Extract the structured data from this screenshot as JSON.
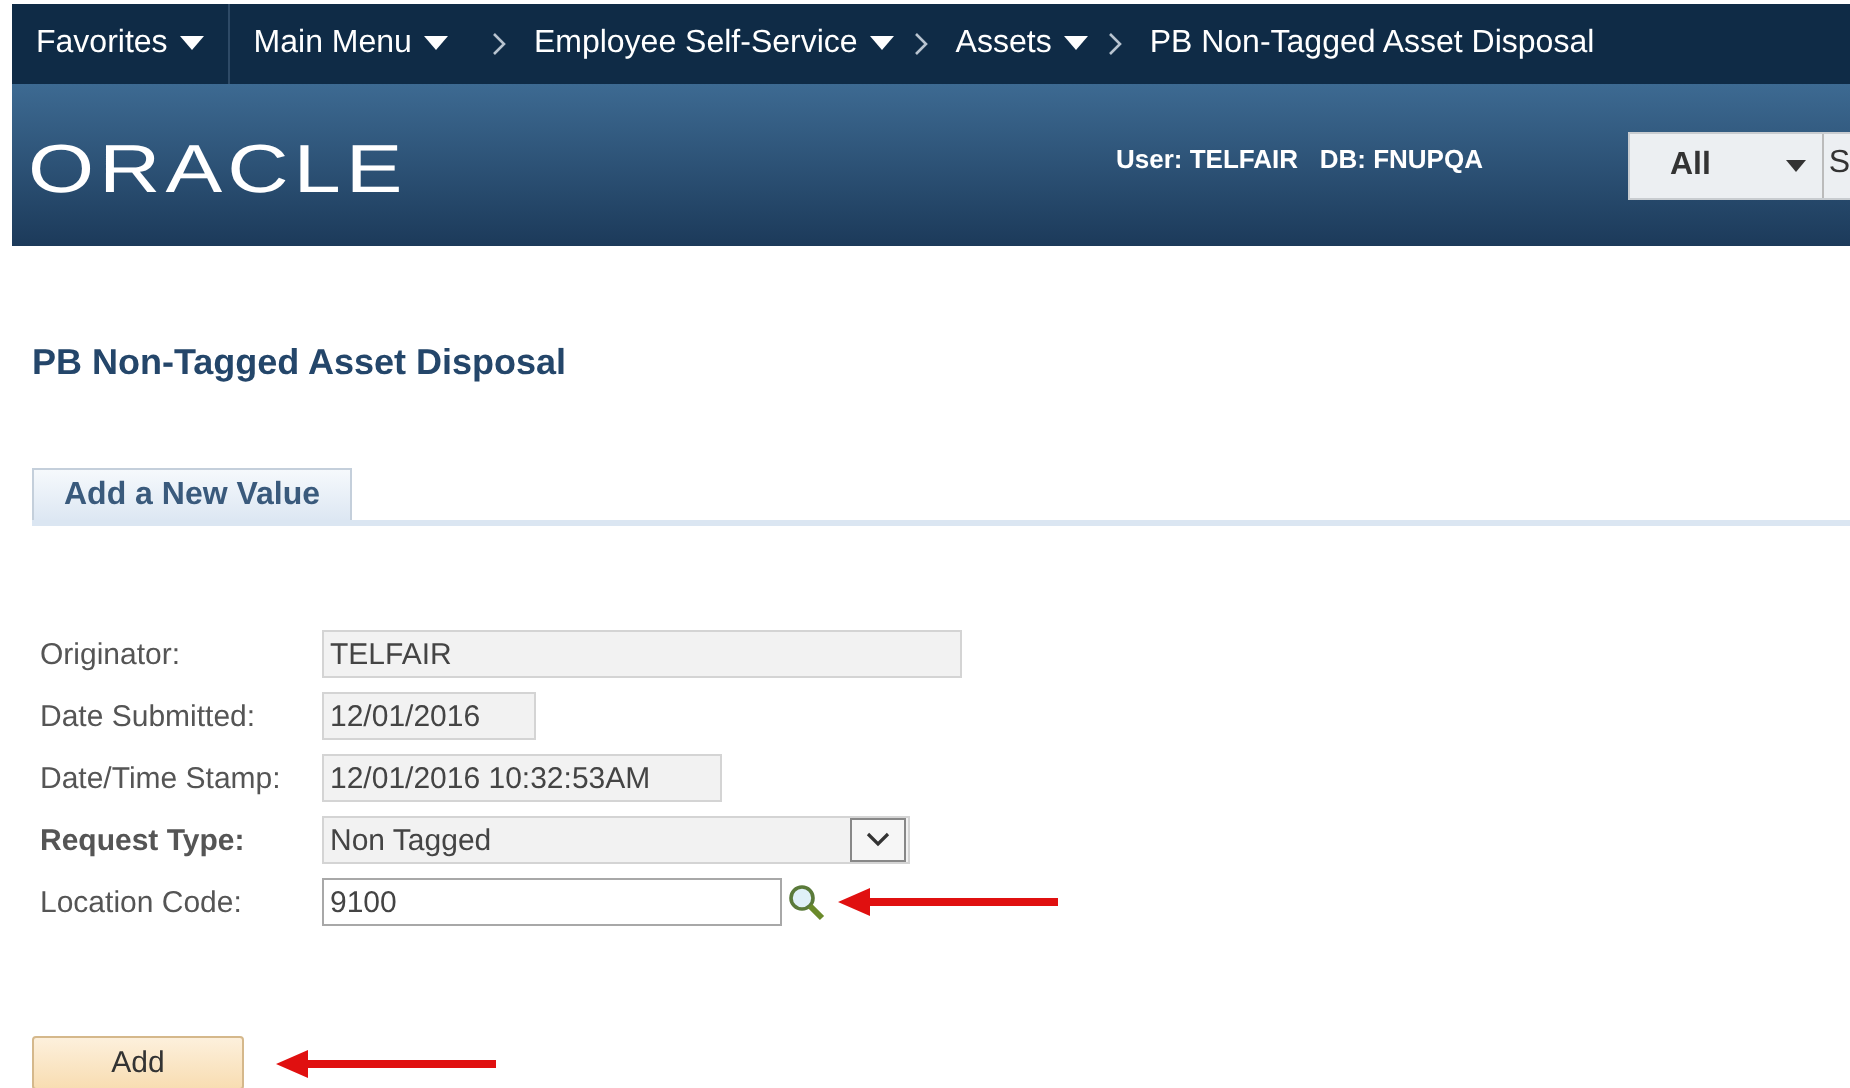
{
  "nav": [
    {
      "label": "Favorites",
      "kind": "menu"
    },
    {
      "label": "Main Menu",
      "kind": "menu"
    },
    {
      "label": "Employee Self-Service",
      "kind": "crumb-menu"
    },
    {
      "label": "Assets",
      "kind": "crumb-menu"
    },
    {
      "label": "PB Non-Tagged Asset Disposal",
      "kind": "crumb"
    }
  ],
  "header": {
    "logo": "ORACLE",
    "user": "User: TELFAIR",
    "db": "DB: FNUPQA",
    "search_scope": "All",
    "search_text": "S"
  },
  "page_title": "PB Non-Tagged Asset Disposal",
  "tabs": [
    {
      "label": "Add a New Value",
      "selected": true
    }
  ],
  "fields": [
    {
      "label": "Originator:",
      "value": "TELFAIR",
      "kind": "readonly",
      "bold": false,
      "arrow": false
    },
    {
      "label": "Date Submitted:",
      "value": "12/01/2016",
      "kind": "readonly",
      "bold": false,
      "arrow": false
    },
    {
      "label": "Date/Time Stamp:",
      "value": "12/01/2016 10:32:53AM",
      "kind": "readonly",
      "bold": false,
      "arrow": false
    },
    {
      "label": "Request Type:",
      "value": "Non Tagged",
      "kind": "select",
      "bold": true,
      "arrow": false
    },
    {
      "label": "Location Code:",
      "value": "9100",
      "kind": "lookup",
      "bold": false,
      "arrow": true
    }
  ],
  "add_button": {
    "label": "Add",
    "arrow": true
  }
}
